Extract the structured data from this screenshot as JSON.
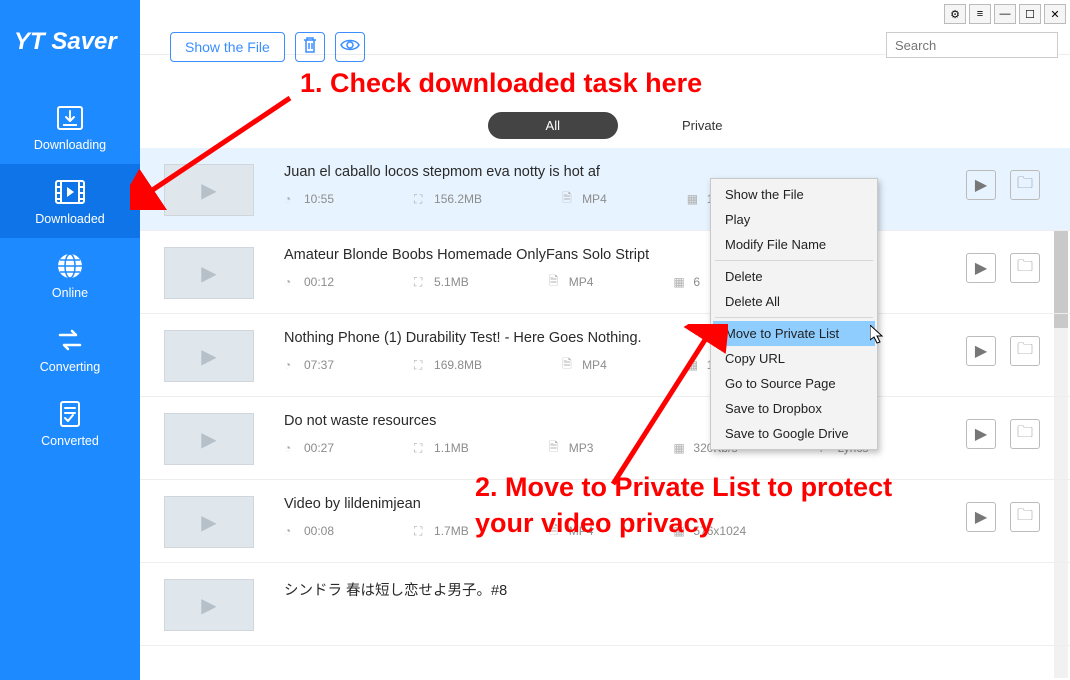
{
  "app_title": "YT Saver",
  "window_buttons": {
    "gear": "⚙",
    "menu": "≡",
    "min": "—",
    "max": "☐",
    "close": "✕"
  },
  "toolbar": {
    "show_file": "Show the File",
    "search_placeholder": "Search"
  },
  "sidebar": {
    "items": [
      {
        "label": "Downloading"
      },
      {
        "label": "Downloaded"
      },
      {
        "label": "Online"
      },
      {
        "label": "Converting"
      },
      {
        "label": "Converted"
      }
    ]
  },
  "filters": {
    "all": "All",
    "private": "Private"
  },
  "rows": [
    {
      "title": "Juan el caballo locos stepmom eva notty is hot af",
      "duration": "10:55",
      "size": "156.2MB",
      "format": "MP4",
      "res": "1"
    },
    {
      "title": "Amateur Blonde Boobs Homemade OnlyFans Solo Stript",
      "duration": "00:12",
      "size": "5.1MB",
      "format": "MP4",
      "res": "6"
    },
    {
      "title": "Nothing Phone (1) Durability Test! - Here Goes Nothing.",
      "duration": "07:37",
      "size": "169.8MB",
      "format": "MP4",
      "res": "1"
    },
    {
      "title": "Do not waste resources",
      "duration": "00:27",
      "size": "1.1MB",
      "format": "MP3",
      "res": "320Kb/s",
      "extra": "Lyrics"
    },
    {
      "title": "Video by lildenimjean",
      "duration": "00:08",
      "size": "1.7MB",
      "format": "MP4",
      "res": "576x1024"
    },
    {
      "title": "シンドラ 春は短し恋せよ男子。#8",
      "duration": "",
      "size": "",
      "format": "",
      "res": ""
    }
  ],
  "context_menu": {
    "items": [
      "Show the File",
      "Play",
      "Modify File Name",
      "Delete",
      "Delete All",
      "Move to Private List",
      "Copy URL",
      "Go to Source Page",
      "Save to Dropbox",
      "Save to Google Drive"
    ]
  },
  "annotations": {
    "a1": "1. Check downloaded task here",
    "a2_line1": "2. Move to Private List to protect",
    "a2_line2": "your video privacy"
  }
}
